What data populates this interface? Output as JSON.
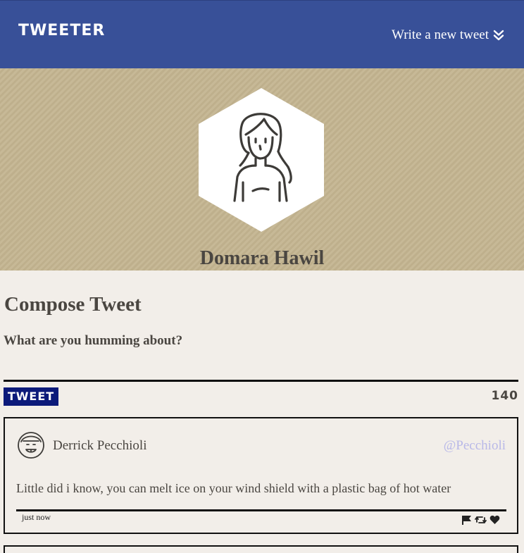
{
  "nav": {
    "brand": "TWEETER",
    "write_link": "Write a new tweet",
    "write_icon": "double-chevron-down-icon"
  },
  "profile": {
    "name": "Domara Hawil",
    "avatar_icon": "woman-avatar-icon"
  },
  "compose": {
    "title": "Compose Tweet",
    "placeholder": "What are you humming about?",
    "button_label": "TWEET",
    "counter": "140"
  },
  "tweets": [
    {
      "author": "Derrick Pecchioli",
      "handle": "@Pecchioli",
      "text": "Little did i know, you can melt ice on your wind shield with a plastic bag of hot water",
      "time": "just now",
      "avatar_icon": "smiling-man-avatar-icon",
      "actions": [
        "flag-icon",
        "retweet-icon",
        "heart-icon"
      ]
    }
  ],
  "colors": {
    "navbar": "#385098",
    "header": "#c4b591",
    "background": "#f2eee9",
    "tweet_button": "#0c1a7a",
    "handle": "#b8b8e8"
  }
}
